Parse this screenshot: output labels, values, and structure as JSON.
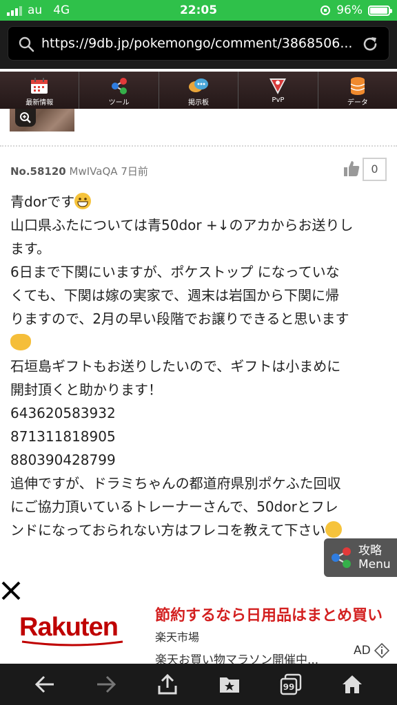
{
  "status_bar": {
    "carrier": "au",
    "network": "4G",
    "time": "22:05",
    "battery": "96%",
    "battery_level": 0.96,
    "bg_color": "#2fc14a"
  },
  "url_bar": {
    "url": "https://9db.jp/pokemongo/comment/3868506..."
  },
  "nav": {
    "items": [
      {
        "label": "最新情報",
        "icon": "calendar-icon"
      },
      {
        "label": "ツール",
        "icon": "share-icon"
      },
      {
        "label": "掲示板",
        "icon": "chat-bubbles-icon"
      },
      {
        "label": "PvP",
        "icon": "pvp-shield-icon"
      },
      {
        "label": "データ",
        "icon": "database-icon"
      }
    ]
  },
  "comment": {
    "number": "No.58120",
    "user_id": "MwIVaQA",
    "posted": "7日前",
    "likes": "0",
    "lines": [
      "青dorです",
      "山口県ふたについては青50dor +↓のアカからお送りし",
      "ます。",
      "6日まで下関にいますが、ポケストップ になっていな",
      "くても、下関は嫁の実家で、週末は岩国から下関に帰",
      "りますので、2月の早い段階でお譲りできると思います",
      "",
      "石垣島ギフトもお送りしたいので、ギフトは小まめに",
      "開封頂くと助かります！",
      "643620583932",
      "871311818905",
      "880390428799",
      "追伸ですが、ドラミちゃんの都道府県別ポケふた回収",
      "にご協力頂いているトレーナーさんで、50dorとフレ",
      "ンドになっておられない方はフレコを教えて下さい"
    ]
  },
  "guide_button": {
    "line1": "攻略",
    "line2": "Menu"
  },
  "ad": {
    "brand": "Rakuten",
    "headline": "節約するなら日用品はまとめ買い",
    "shop": "楽天市場",
    "description": "楽天お買い物マラソン開催中...",
    "label": "AD",
    "brand_color": "#bf0000",
    "headline_color": "#d32020"
  },
  "toolbar": {
    "items": [
      "back-arrow-icon",
      "forward-arrow-icon",
      "share-upload-icon",
      "bookmark-star-icon",
      "tabs-icon",
      "home-icon"
    ],
    "tabs_count": "99"
  }
}
